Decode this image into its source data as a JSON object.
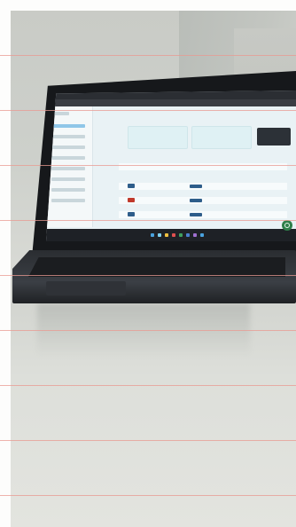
{
  "scene": {
    "subject": "laptop-on-table",
    "screen_app": "web-dashboard",
    "paper_lines_color": "#e89a92",
    "bezel_color": "#16181b",
    "screen_color": "#e9f2f5",
    "accent_blue": "#2e5d8a",
    "accent_red": "#c0392b",
    "whatsapp_green": "#2f7f4a"
  }
}
